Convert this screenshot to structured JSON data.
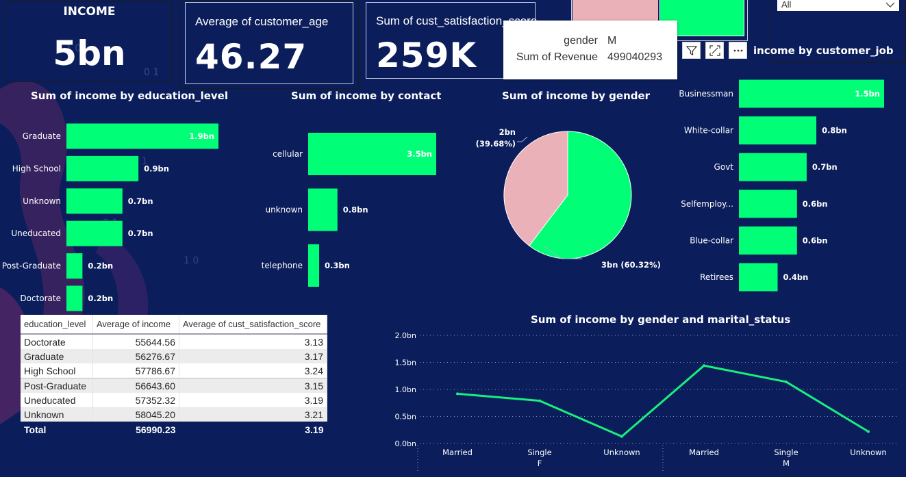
{
  "colors": {
    "background": "#0b1e5b",
    "bar": "#00ff77",
    "female": "#ebb1b9",
    "line": "#17f07e"
  },
  "kpi_income": {
    "label": "INCOME",
    "value": "5bn"
  },
  "kpi_age": {
    "label": "Average of customer_age",
    "value": "46.27"
  },
  "kpi_satisfaction": {
    "label": "Sum of cust_satisfaction_score",
    "value": "259K"
  },
  "slicer": {
    "selected": "All",
    "icon": "chevron-down-icon"
  },
  "tooltip": {
    "rows": [
      {
        "key": "gender",
        "value": "M"
      },
      {
        "key": "Sum of Revenue",
        "value": "499040293"
      }
    ]
  },
  "visual_header": {
    "icons": [
      "filter-icon",
      "focus-mode-icon",
      "more-options-icon"
    ]
  },
  "titles": {
    "education": "Sum of income by education_level",
    "contact": "Sum of income by contact",
    "gender": "Sum of income by gender",
    "job": "Sum of income by customer_job",
    "job_visible": "income by customer_job",
    "line": "Sum of income by gender and marital_status"
  },
  "chart_data": [
    {
      "type": "bar",
      "orientation": "horizontal",
      "id": "education",
      "title": "Sum of income by education_level",
      "categories": [
        "Graduate",
        "High School",
        "Unknown",
        "Uneducated",
        "Post-Graduate",
        "Doctorate"
      ],
      "values": [
        1.9,
        0.9,
        0.7,
        0.7,
        0.2,
        0.2
      ],
      "labels": [
        "1.9bn",
        "0.9bn",
        "0.7bn",
        "0.7bn",
        "0.2bn",
        "0.2bn"
      ],
      "xlim": [
        0,
        1.9
      ],
      "grid": false
    },
    {
      "type": "bar",
      "orientation": "horizontal",
      "id": "contact",
      "title": "Sum of income by contact",
      "categories": [
        "cellular",
        "unknown",
        "telephone"
      ],
      "values": [
        3.5,
        0.8,
        0.3
      ],
      "labels": [
        "3.5bn",
        "0.8bn",
        "0.3bn"
      ],
      "xlim": [
        0,
        3.5
      ],
      "grid": false
    },
    {
      "type": "pie",
      "id": "gender",
      "title": "Sum of income by gender",
      "slices": [
        {
          "name": "M",
          "value": 60.32,
          "label": "3bn (60.32%)",
          "color": "#00ff77"
        },
        {
          "name": "F",
          "value": 39.68,
          "label_value": "2bn",
          "label_pct": "(39.68%)",
          "color": "#ebb1b9"
        }
      ]
    },
    {
      "type": "bar",
      "orientation": "horizontal",
      "id": "job",
      "title": "Sum of income by customer_job",
      "categories": [
        "Businessman",
        "White-collar",
        "Govt",
        "Selfemploy...",
        "Blue-collar",
        "Retirees"
      ],
      "values": [
        1.5,
        0.8,
        0.7,
        0.6,
        0.6,
        0.4
      ],
      "labels": [
        "1.5bn",
        "0.8bn",
        "0.7bn",
        "0.6bn",
        "0.6bn",
        "0.4bn"
      ],
      "xlim": [
        0,
        1.5
      ],
      "grid": false
    },
    {
      "type": "line",
      "id": "line",
      "title": "Sum of income by gender and marital_status",
      "x": [
        "Married",
        "Single",
        "Unknown",
        "Married",
        "Single",
        "Unknown"
      ],
      "groups": [
        {
          "name": "F",
          "count": 3
        },
        {
          "name": "M",
          "count": 3
        }
      ],
      "y": [
        0.92,
        0.79,
        0.13,
        1.44,
        1.14,
        0.22
      ],
      "ylim": [
        0,
        2.0
      ],
      "yticks": [
        0,
        0.5,
        1.0,
        1.5,
        2.0
      ],
      "ytick_labels": [
        "0.0bn",
        "0.5bn",
        "1.0bn",
        "1.5bn",
        "2.0bn"
      ],
      "grid": true
    }
  ],
  "table": {
    "columns": [
      "education_level",
      "Average of income",
      "Average of cust_satisfaction_score"
    ],
    "rows": [
      [
        "Doctorate",
        "55644.56",
        "3.13"
      ],
      [
        "Graduate",
        "56276.67",
        "3.17"
      ],
      [
        "High School",
        "57786.67",
        "3.24"
      ],
      [
        "Post-Graduate",
        "56643.60",
        "3.15"
      ],
      [
        "Uneducated",
        "57352.32",
        "3.19"
      ],
      [
        "Unknown",
        "58045.20",
        "3.21"
      ]
    ],
    "total": [
      "Total",
      "56990.23",
      "3.19"
    ]
  }
}
